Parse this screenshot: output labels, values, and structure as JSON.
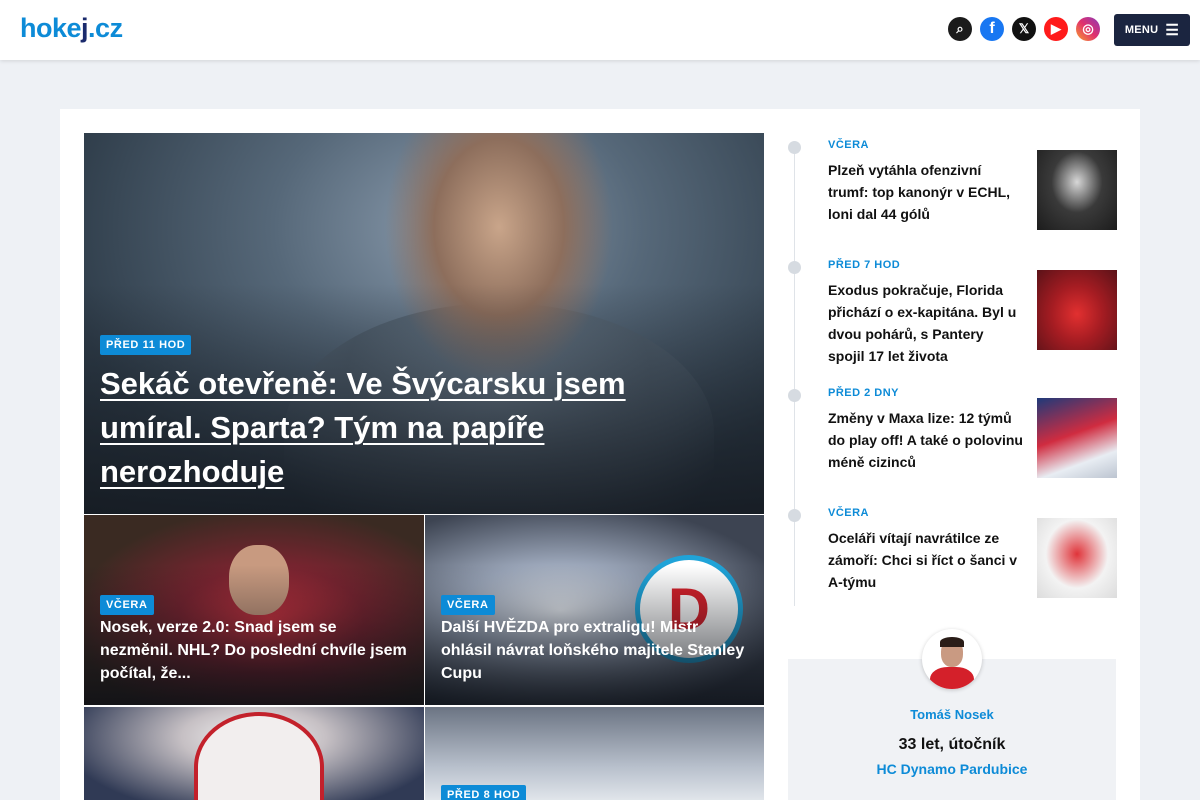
{
  "header": {
    "logo": "hokej.cz",
    "menu_label": "MENU",
    "icons": [
      "search-icon",
      "facebook-icon",
      "x-icon",
      "youtube-icon",
      "instagram-icon"
    ]
  },
  "hero": {
    "time": "PŘED 11 HOD",
    "title": "Sekáč otevřeně: Ve Švýcarsku jsem umíral. Sparta? Tým na papíře nerozhoduje"
  },
  "tiles": [
    {
      "time": "VČERA",
      "title": "Nosek, verze 2.0: Snad jsem se nezměnil. NHL? Do poslední chvíle jsem počítal, že..."
    },
    {
      "time": "VČERA",
      "title": "Další HVĚZDA pro extraligu! Mistr ohlásil návrat loňského majitele Stanley Cupu"
    },
    {
      "time": "",
      "title": ""
    },
    {
      "time": "PŘED 8 HOD",
      "title": ""
    }
  ],
  "sidebar": {
    "news": [
      {
        "time": "VČERA",
        "title": "Plzeň vytáhla ofenzivní trumf: top kanonýr v ECHL, loni dal 44 gólů"
      },
      {
        "time": "PŘED 7 HOD",
        "title": "Exodus pokračuje, Florida přichází o ex-kapitána. Byl u dvou pohárů, s Pantery spojil 17 let života"
      },
      {
        "time": "PŘED 2 DNY",
        "title": "Změny v Maxa lize: 12 týmů do play off! A také o polovinu méně cizinců"
      },
      {
        "time": "VČERA",
        "title": "Oceláři vítají navrátilce ze zámoří: Chci si říct o šanci v A-týmu"
      }
    ],
    "player": {
      "name": "Tomáš Nosek",
      "info": "33 let, útočník",
      "team": "HC Dynamo Pardubice"
    }
  },
  "colors": {
    "accent": "#0d8bd7",
    "menu_bg": "#1b2540"
  }
}
